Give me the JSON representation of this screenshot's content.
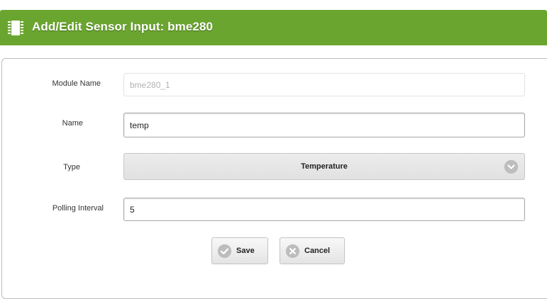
{
  "header": {
    "title": "Add/Edit Sensor Input: bme280",
    "icon": "chip-icon",
    "color": "#6aa52f"
  },
  "form": {
    "module_name": {
      "label": "Module Name",
      "placeholder": "bme280_1"
    },
    "name": {
      "label": "Name",
      "value": "temp"
    },
    "type": {
      "label": "Type",
      "selected": "Temperature"
    },
    "polling_interval": {
      "label": "Polling Interval",
      "value": "5"
    }
  },
  "buttons": {
    "save": {
      "label": "Save",
      "icon": "check-icon"
    },
    "cancel": {
      "label": "Cancel",
      "icon": "close-icon"
    }
  }
}
